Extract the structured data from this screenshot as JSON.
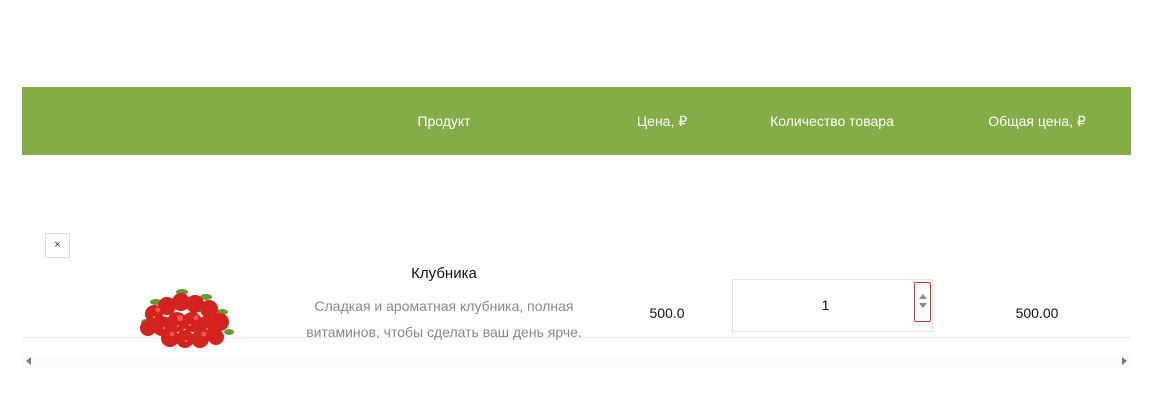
{
  "cart_table": {
    "headers": {
      "product": "Продукт",
      "price": "Цена, ₽",
      "quantity": "Количество товара",
      "total": "Общая цена, ₽"
    },
    "items": [
      {
        "remove_label": "×",
        "image_icon": "strawberries-image",
        "name": "Клубника",
        "description_line1": "Сладкая и ароматная клубника, полная",
        "description_line2": "витаминов, чтобы сделать ваш день ярче.",
        "price": "500.0",
        "quantity": "1",
        "total": "500.00"
      }
    ]
  },
  "colors": {
    "header_bg": "#84ad47",
    "header_text": "#ffffff",
    "spinner_focus_border": "#cc3333"
  }
}
